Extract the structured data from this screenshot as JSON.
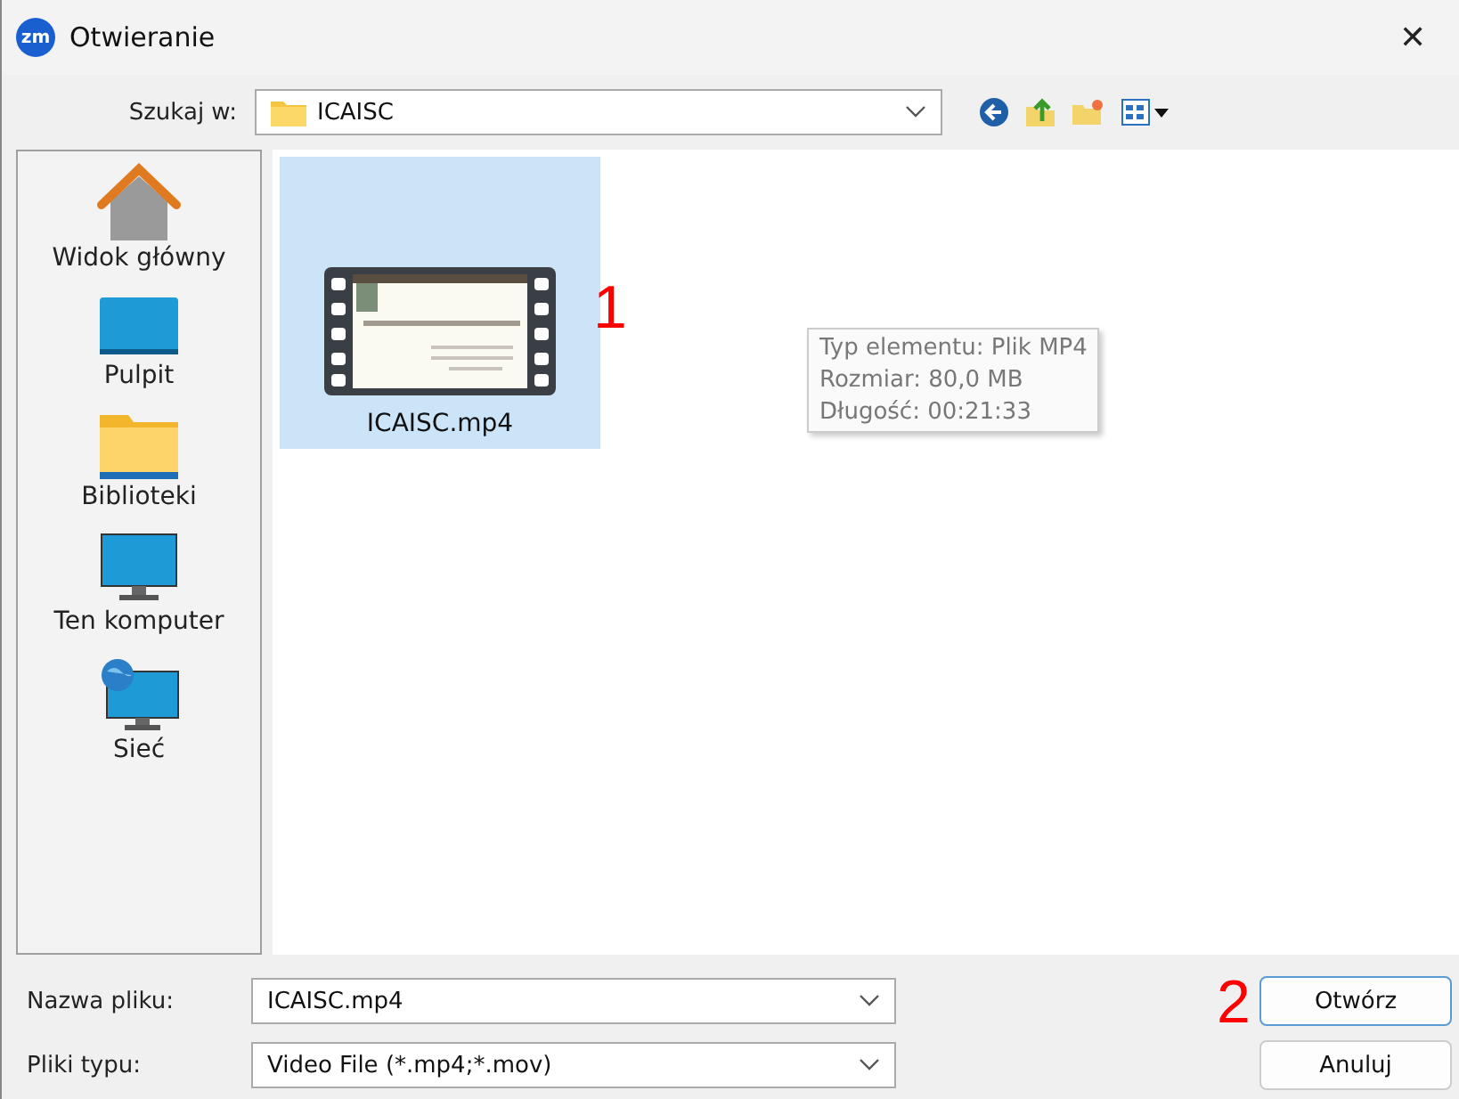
{
  "window": {
    "app_badge": "zm",
    "title": "Otwieranie",
    "close": "✕"
  },
  "location": {
    "label": "Szukaj w:",
    "value": "ICAISC"
  },
  "places": [
    {
      "label": "Widok główny",
      "kind": "home"
    },
    {
      "label": "Pulpit",
      "kind": "desktop"
    },
    {
      "label": "Biblioteki",
      "kind": "folder"
    },
    {
      "label": "Ten komputer",
      "kind": "computer"
    },
    {
      "label": "Sieć",
      "kind": "network"
    }
  ],
  "files": [
    {
      "name": "ICAISC.mp4",
      "selected": true
    }
  ],
  "tooltip": [
    "Typ elementu: Plik MP4",
    "Rozmiar: 80,0 MB",
    "Długość: 00:21:33"
  ],
  "annotations": [
    "1",
    "2"
  ],
  "filename": {
    "label": "Nazwa pliku:",
    "value": "ICAISC.mp4"
  },
  "filetype": {
    "label": "Pliki typu:",
    "value": "Video File (*.mp4;*.mov)"
  },
  "buttons": [
    "Otwórz",
    "Anuluj"
  ]
}
